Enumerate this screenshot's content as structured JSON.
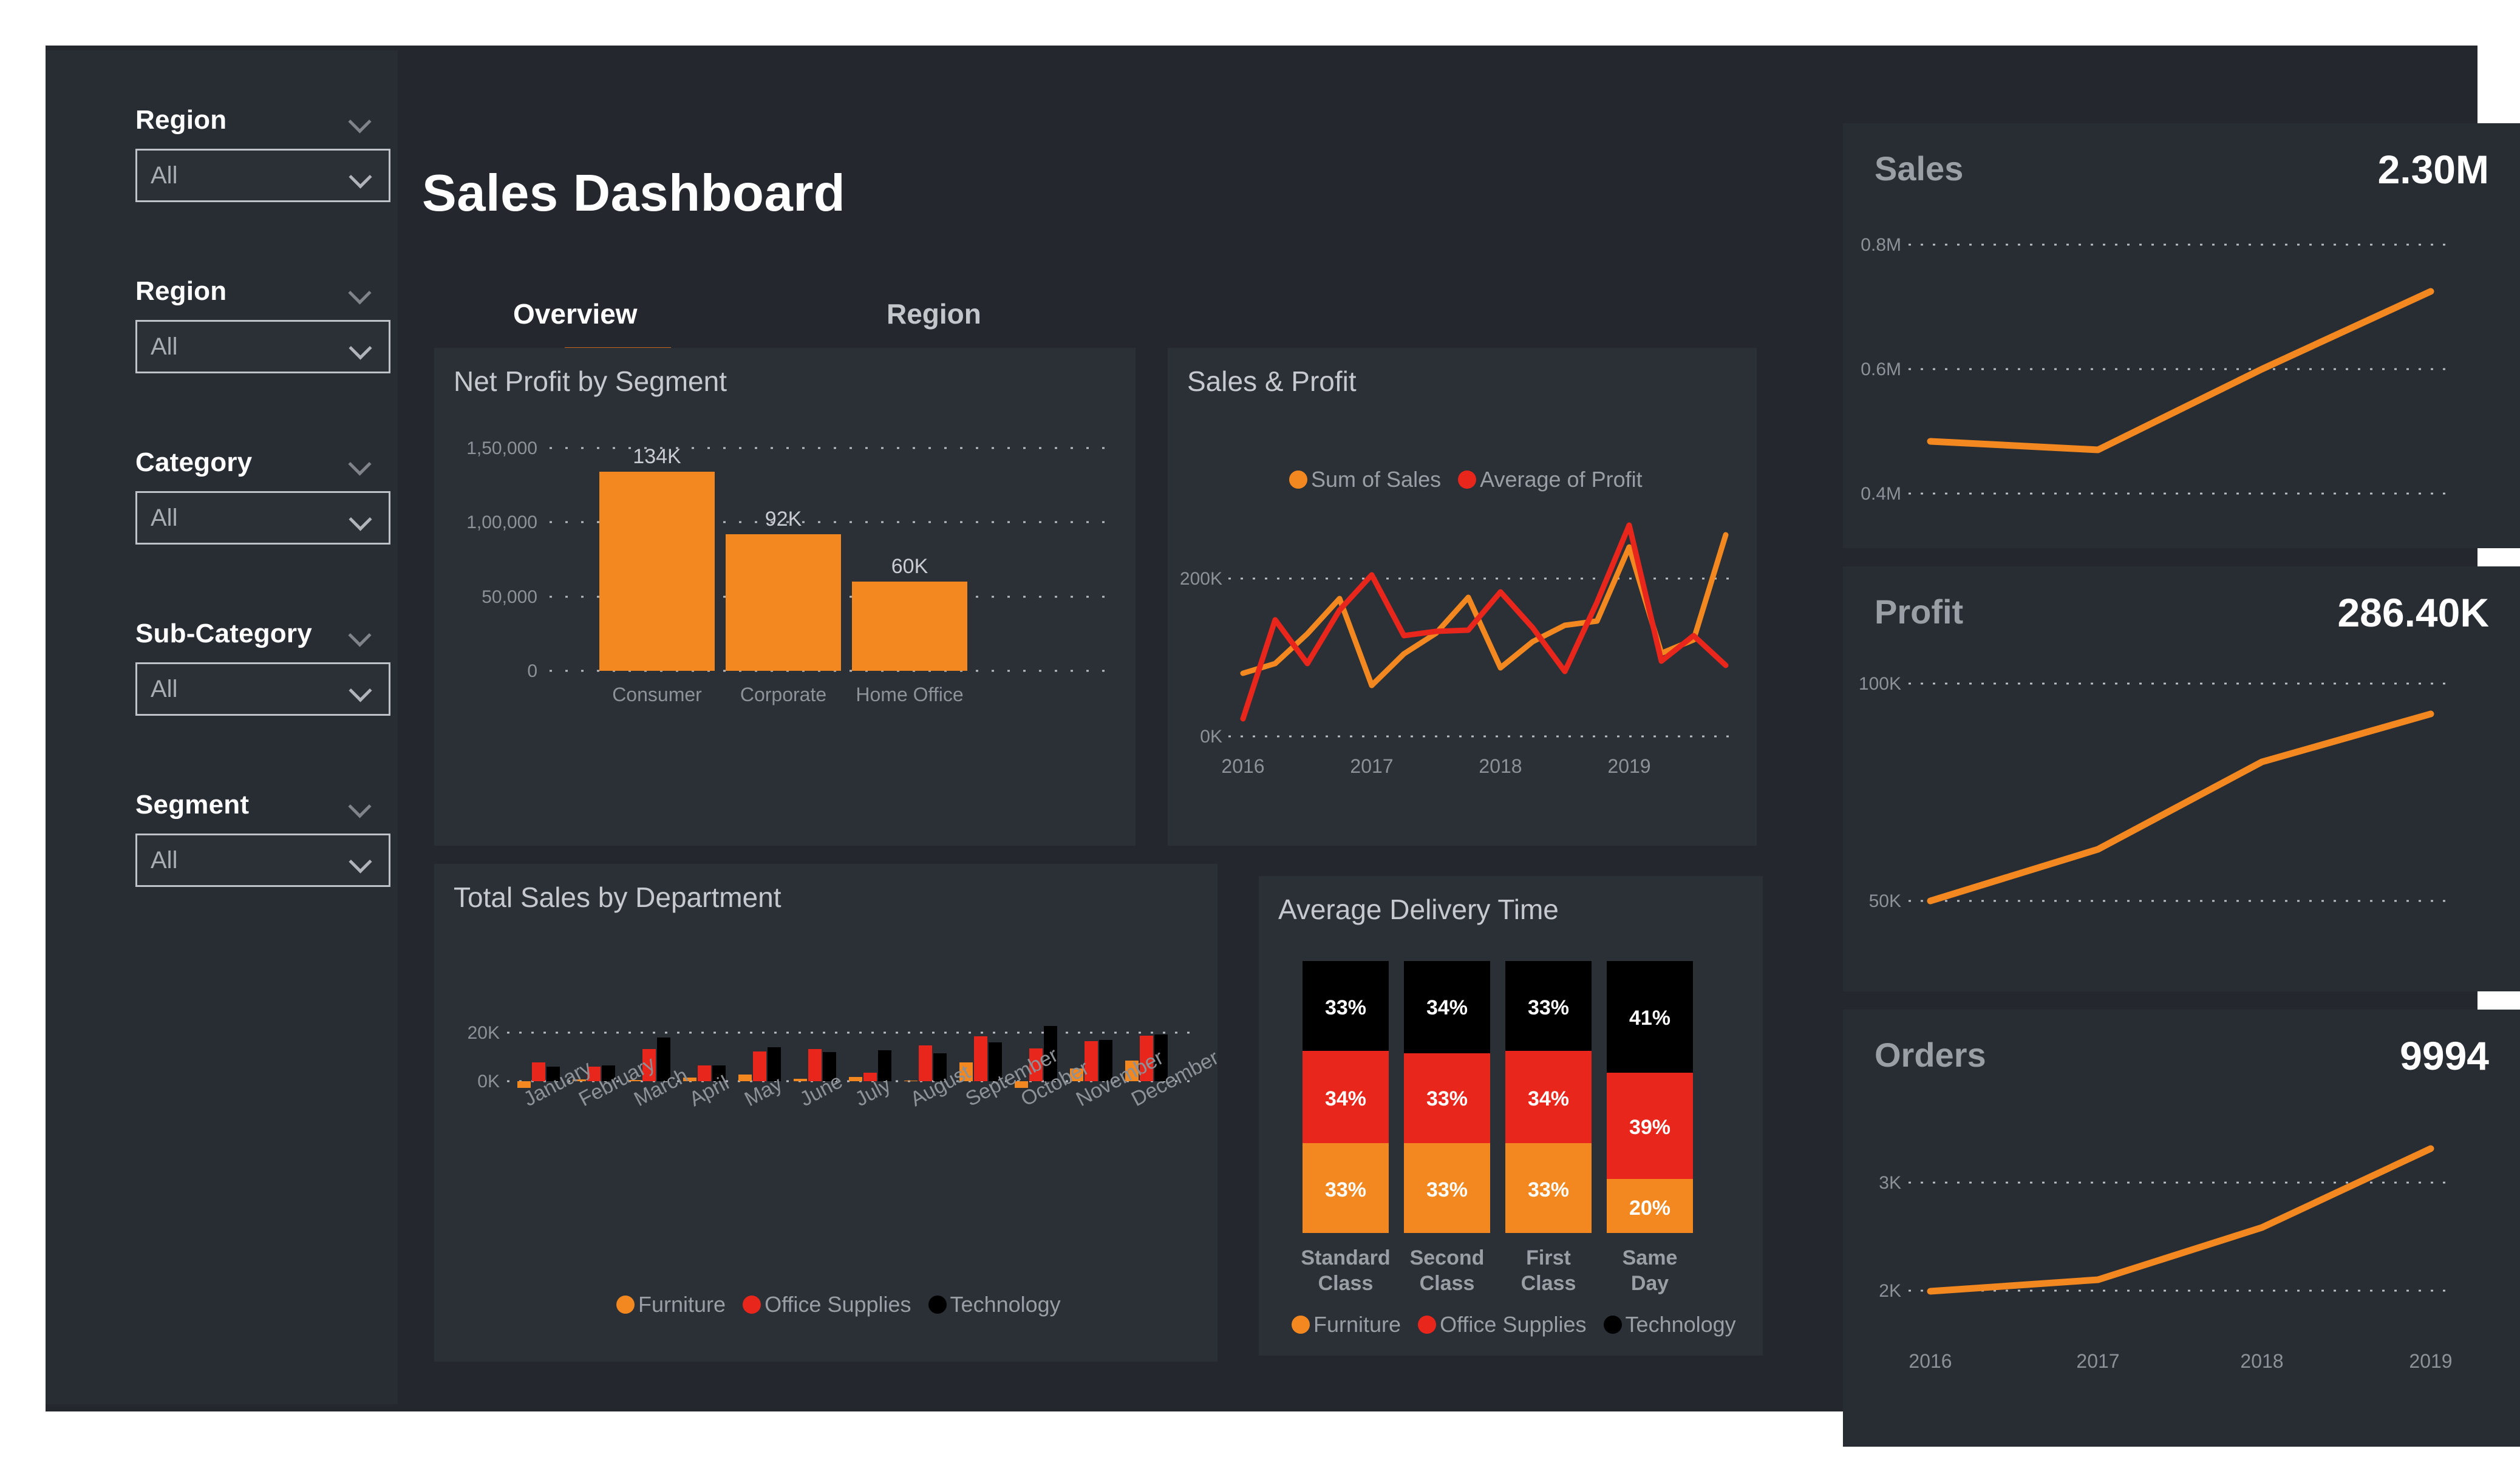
{
  "page": {
    "title": "Sales Dashboard",
    "background": "#24272d",
    "panel_background": "#2b2f36",
    "sidebar_background": "#282c33",
    "accent": "#F2881F",
    "accent_red": "#E8261C",
    "accent_black": "#000000",
    "tab_underline": "#c2651f"
  },
  "sidebar": {
    "slicers": [
      {
        "label": "Region",
        "value": "All",
        "icon": "chevron-down-icon"
      },
      {
        "label": "Region",
        "value": "All",
        "icon": "chevron-down-icon"
      },
      {
        "label": "Category",
        "value": "All",
        "icon": "chevron-down-icon"
      },
      {
        "label": "Sub-Category",
        "value": "All",
        "icon": "chevron-down-icon"
      },
      {
        "label": "Segment",
        "value": "All",
        "icon": "chevron-down-icon"
      }
    ]
  },
  "tabs": [
    {
      "label": "Overview",
      "active": true
    },
    {
      "label": "Region",
      "active": false
    }
  ],
  "kpis": [
    {
      "label": "Sales",
      "value": "2.30M",
      "yticks": [
        "0.8M",
        "0.6M",
        "0.4M"
      ]
    },
    {
      "label": "Profit",
      "value": "286.40K",
      "yticks": [
        "100K",
        "50K"
      ]
    },
    {
      "label": "Orders",
      "value": "9994",
      "yticks": [
        "3K",
        "2K"
      ],
      "xticks": [
        "2016",
        "2017",
        "2018",
        "2019"
      ]
    }
  ],
  "chart_data": [
    {
      "id": "net-profit-by-segment",
      "type": "bar",
      "title": "Net Profit by Segment",
      "categories": [
        "Consumer",
        "Corporate",
        "Home Office"
      ],
      "values": [
        134000,
        92000,
        60000
      ],
      "data_labels": [
        "134K",
        "92K",
        "60K"
      ],
      "yticks": [
        "1,50,000",
        "1,00,000",
        "50,000",
        "0"
      ],
      "ytick_values": [
        150000,
        100000,
        50000,
        0
      ],
      "ylim": [
        0,
        150000
      ],
      "xlabel": "",
      "ylabel": "",
      "grid": true,
      "series_color": "#F2881F"
    },
    {
      "id": "sales-and-profit",
      "type": "line",
      "title": "Sales & Profit",
      "xlabel": "",
      "ylabel": "",
      "yticks": [
        "200K",
        "0K"
      ],
      "ytick_values": [
        200000,
        0
      ],
      "ylim": [
        0,
        300000
      ],
      "xticks": [
        "2016",
        "2017",
        "2018",
        "2019"
      ],
      "grid": true,
      "legend_position": "top",
      "series": [
        {
          "name": "Sum of Sales",
          "color": "#F2881F",
          "values": [
            80000,
            92000,
            130000,
            175000,
            65000,
            95000,
            132000,
            180000,
            88000,
            120000,
            140000,
            145000,
            240000,
            108000,
            122000,
            255000
          ]
        },
        {
          "name": "Average of Profit",
          "color": "#E8261C",
          "values": [
            22000,
            148000,
            92000,
            160000,
            205000,
            128000,
            133000,
            135000,
            183000,
            138000,
            82000,
            170000,
            268000,
            95000,
            128000,
            90000
          ]
        }
      ]
    },
    {
      "id": "total-sales-by-department",
      "type": "bar",
      "title": "Total Sales by Department",
      "categories": [
        "January",
        "February",
        "March",
        "April",
        "May",
        "June",
        "July",
        "August",
        "September",
        "October",
        "November",
        "December"
      ],
      "yticks": [
        "20K",
        "0K"
      ],
      "ytick_values": [
        20000,
        0
      ],
      "ylim": [
        -3000,
        24000
      ],
      "grid": true,
      "legend_position": "bottom",
      "series": [
        {
          "name": "Furniture",
          "color": "#F2881F",
          "values": [
            -2600,
            700,
            600,
            1500,
            2700,
            1100,
            1800,
            300,
            7700,
            -2800,
            5300,
            8600
          ]
        },
        {
          "name": "Office Supplies",
          "color": "#E8261C",
          "values": [
            7700,
            5900,
            13300,
            6600,
            12200,
            13300,
            3500,
            14800,
            18400,
            13500,
            16600,
            18900
          ]
        },
        {
          "name": "Technology",
          "color": "#000000",
          "values": [
            5900,
            6500,
            18100,
            6500,
            14000,
            11900,
            12700,
            11600,
            16100,
            22800,
            16900,
            19400
          ]
        }
      ]
    },
    {
      "id": "average-delivery-time",
      "type": "bar",
      "stacked": true,
      "title": "Average Delivery Time",
      "categories": [
        "Standard Class",
        "Second Class",
        "First Class",
        "Same Day"
      ],
      "category_lines": [
        [
          "Standard",
          "Class"
        ],
        [
          "Second",
          "Class"
        ],
        [
          "First",
          "Class"
        ],
        [
          "Same",
          "Day"
        ]
      ],
      "legend_position": "bottom",
      "series": [
        {
          "name": "Furniture",
          "color": "#F2881F",
          "values": [
            33,
            33,
            33,
            20
          ],
          "labels": [
            "33%",
            "33%",
            "33%",
            "20%"
          ]
        },
        {
          "name": "Office Supplies",
          "color": "#E8261C",
          "values": [
            34,
            33,
            34,
            39
          ],
          "labels": [
            "34%",
            "33%",
            "34%",
            "39%"
          ]
        },
        {
          "name": "Technology",
          "color": "#000000",
          "values": [
            33,
            34,
            33,
            41
          ],
          "labels": [
            "33%",
            "34%",
            "33%",
            "41%"
          ]
        }
      ]
    },
    {
      "id": "sales-sparkline",
      "type": "line",
      "title": "Sales",
      "yticks": [
        "0.8M",
        "0.6M",
        "0.4M"
      ],
      "ytick_values": [
        800000,
        600000,
        400000
      ],
      "values": [
        484000,
        470000,
        610000,
        733000
      ],
      "x": [
        "2016",
        "2017",
        "2018",
        "2019"
      ],
      "color": "#F2881F"
    },
    {
      "id": "profit-sparkline",
      "type": "line",
      "title": "Profit",
      "yticks": [
        "100K",
        "50K"
      ],
      "ytick_values": [
        100000,
        50000
      ],
      "values": [
        50000,
        62000,
        81000,
        90000
      ],
      "x": [
        "2016",
        "2017",
        "2018",
        "2019"
      ],
      "color": "#F2881F"
    },
    {
      "id": "orders-sparkline",
      "type": "line",
      "title": "Orders",
      "yticks": [
        "3K",
        "2K"
      ],
      "ytick_values": [
        3000,
        2000
      ],
      "values": [
        1993,
        2102,
        2587,
        3312
      ],
      "x": [
        "2016",
        "2017",
        "2018",
        "2019"
      ],
      "color": "#F2881F"
    }
  ]
}
